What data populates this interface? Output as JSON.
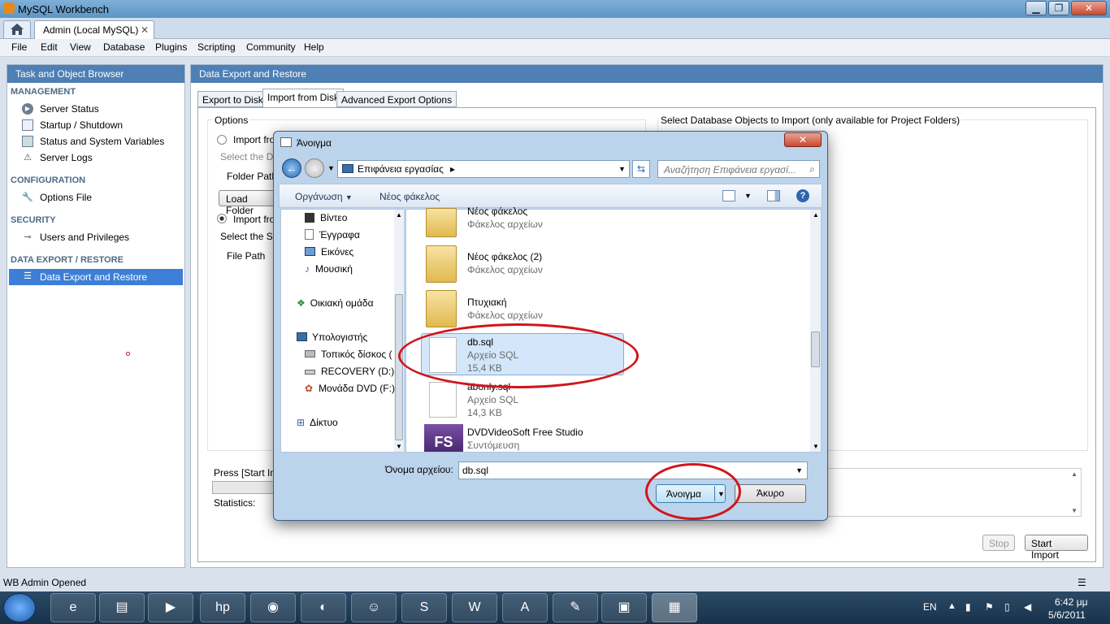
{
  "window": {
    "title": "MySQL Workbench",
    "minimize": "▁",
    "maximize": "❐",
    "close": "✕"
  },
  "tabs": {
    "home_icon": "home-icon",
    "admin": "Admin (Local MySQL)",
    "admin_close": "✕"
  },
  "menu": [
    "File",
    "Edit",
    "View",
    "Database",
    "Plugins",
    "Scripting",
    "Community",
    "Help"
  ],
  "sidebar": {
    "title": "Task and Object Browser",
    "management": "MANAGEMENT",
    "management_items": [
      "Server Status",
      "Startup / Shutdown",
      "Status and System Variables",
      "Server Logs"
    ],
    "configuration": "CONFIGURATION",
    "configuration_items": [
      "Options File"
    ],
    "security": "SECURITY",
    "security_items": [
      "Users and Privileges"
    ],
    "data": "DATA EXPORT / RESTORE",
    "data_items": [
      "Data Export and Restore"
    ]
  },
  "main": {
    "title": "Data Export and Restore",
    "tabs": [
      "Export to Disk",
      "Import from Disk",
      "Advanced Export Options"
    ],
    "options": "Options",
    "import_from_1": "Import fro",
    "select_dump": "Select the Du",
    "folder_path": "Folder Path",
    "load_folder": "Load Folder",
    "import_from_2": "Import fro",
    "select_sql": "Select the SQ",
    "file_path": "File Path",
    "select_objects": "Select Database Objects to Import (only available for Project Folders)",
    "press_start": "Press [Start Im",
    "statistics": "Statistics:",
    "stop": "Stop",
    "start_import": "Start Import"
  },
  "dialog": {
    "title": "Άνοιγμα",
    "close": "✕",
    "location": "Επιφάνεια εργασίας",
    "location_arrow": "▸",
    "search_placeholder": "Αναζήτηση Επιφάνεια εργασί...",
    "organize": "Οργάνωση",
    "new_folder": "Νέος φάκελος",
    "help": "?",
    "nav": [
      "Βίντεο",
      "Έγγραφα",
      "Εικόνες",
      "Μουσική",
      "Οικιακή ομάδα",
      "Υπολογιστής",
      "Τοπικός δίσκος (",
      "RECOVERY (D:)",
      "Μονάδα DVD (F:)",
      "Δίκτυο"
    ],
    "files": [
      {
        "name": "Νέος φάκελος",
        "type": "Φάκελος αρχείων",
        "size": ""
      },
      {
        "name": "Νέος φάκελος (2)",
        "type": "Φάκελος αρχείων",
        "size": ""
      },
      {
        "name": "Πτυχιακή",
        "type": "Φάκελος αρχείων",
        "size": ""
      },
      {
        "name": "db.sql",
        "type": "Αρχείο SQL",
        "size": "15,4 KB"
      },
      {
        "name": "abonly.sql",
        "type": "Αρχείο SQL",
        "size": "14,3 KB"
      },
      {
        "name": "DVDVideoSoft Free Studio",
        "type": "Συντόμευση",
        "size": ""
      }
    ],
    "fs_logo": "FS",
    "filename_label": "Όνομα αρχείου:",
    "filename_value": "db.sql",
    "open": "Άνοιγμα",
    "cancel": "Άκυρο"
  },
  "status": "WB Admin Opened",
  "tray": {
    "lang": "EN",
    "time": "6:42 μμ",
    "date": "5/6/2011"
  },
  "colors": {
    "accent": "#4e7fb5",
    "selected": "#3d7fd6",
    "highlight": "#d0151c"
  }
}
